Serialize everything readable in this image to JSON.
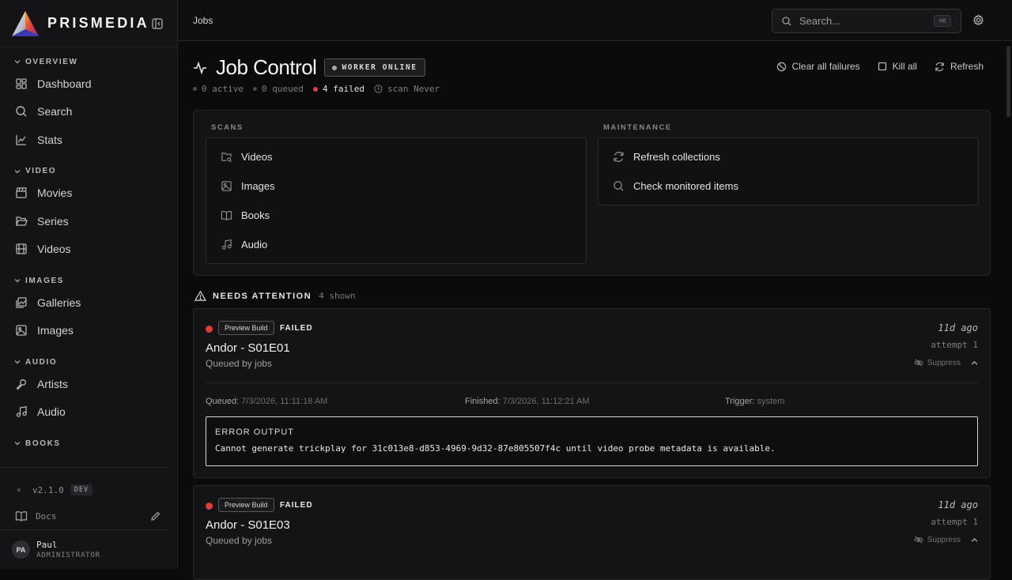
{
  "brand": {
    "name": "PRISMEDIA"
  },
  "sidebar": {
    "sections": [
      {
        "title": "OVERVIEW",
        "items": [
          {
            "label": "Dashboard"
          },
          {
            "label": "Search"
          },
          {
            "label": "Stats"
          }
        ]
      },
      {
        "title": "VIDEO",
        "items": [
          {
            "label": "Movies"
          },
          {
            "label": "Series"
          },
          {
            "label": "Videos"
          }
        ]
      },
      {
        "title": "IMAGES",
        "items": [
          {
            "label": "Galleries"
          },
          {
            "label": "Images"
          }
        ]
      },
      {
        "title": "AUDIO",
        "items": [
          {
            "label": "Artists"
          },
          {
            "label": "Audio"
          }
        ]
      },
      {
        "title": "BOOKS",
        "items": []
      }
    ],
    "version": "v2.1.0",
    "version_badge": "DEV",
    "docs_label": "Docs",
    "user": {
      "initials": "PA",
      "name": "Paul",
      "role": "ADMINISTRATOR"
    }
  },
  "topbar": {
    "breadcrumb": "Jobs",
    "search_placeholder": "Search...",
    "search_shortcut": "⌘K"
  },
  "page": {
    "title": "Job Control",
    "worker_status": "WORKER ONLINE",
    "stats": {
      "active": "0 active",
      "queued": "0 queued",
      "failed": "4 failed",
      "scan": "scan Never"
    },
    "actions": {
      "clear": "Clear all failures",
      "kill": "Kill all",
      "refresh": "Refresh"
    }
  },
  "scans": {
    "label": "SCANS",
    "items": [
      {
        "label": "Videos"
      },
      {
        "label": "Images"
      },
      {
        "label": "Books"
      },
      {
        "label": "Audio"
      }
    ]
  },
  "maintenance": {
    "label": "MAINTENANCE",
    "items": [
      {
        "label": "Refresh collections"
      },
      {
        "label": "Check monitored items"
      }
    ]
  },
  "attention": {
    "title": "NEEDS ATTENTION",
    "count": "4 shown"
  },
  "jobs": [
    {
      "type": "Preview Build",
      "status": "FAILED",
      "title": "Andor - S01E01",
      "queued_by": "Queued by jobs",
      "ago": "11d ago",
      "attempt": "attempt 1",
      "suppress": "Suppress",
      "queued_label": "Queued:",
      "queued_value": "7/3/2026, 11:11:18 AM",
      "finished_label": "Finished:",
      "finished_value": "7/3/2026, 11:12:21 AM",
      "trigger_label": "Trigger:",
      "trigger_value": "system",
      "error_title": "ERROR OUTPUT",
      "error_message": "Cannot generate trickplay for 31c013e8-d853-4969-9d32-87e805507f4c until video probe metadata is available."
    },
    {
      "type": "Preview Build",
      "status": "FAILED",
      "title": "Andor - S01E03",
      "queued_by": "Queued by jobs",
      "ago": "11d ago",
      "attempt": "attempt 1",
      "suppress": "Suppress"
    }
  ]
}
